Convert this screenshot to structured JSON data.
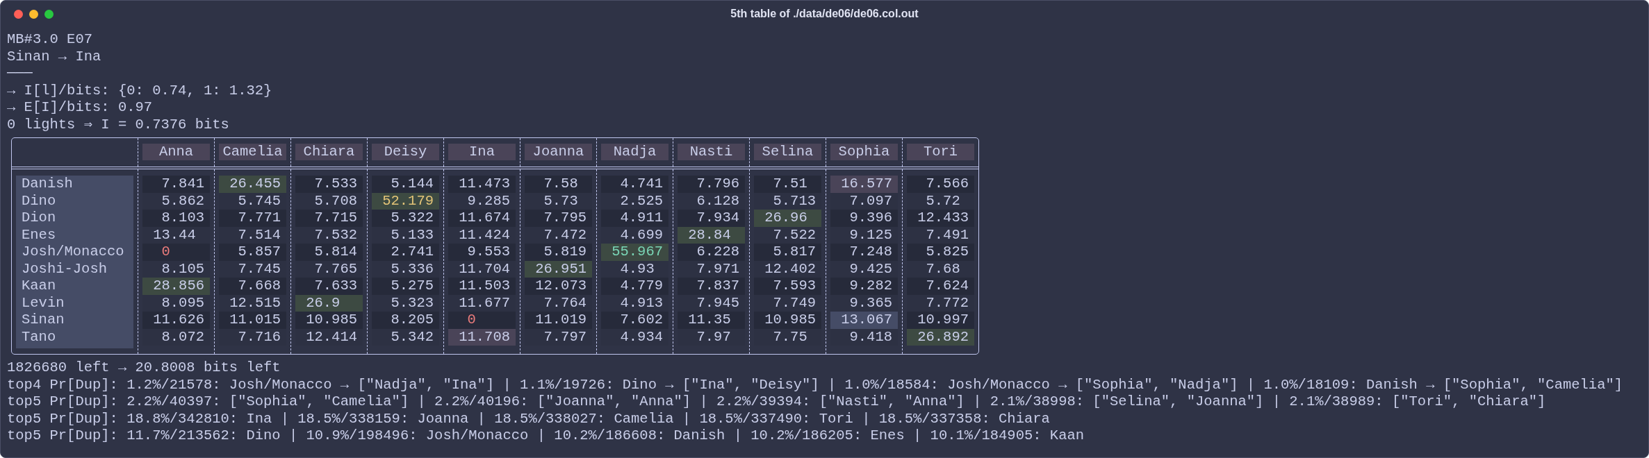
{
  "window": {
    "title": "5th table of ./data/de06/de06.col.out"
  },
  "header_lines": [
    "MB#3.0 E07",
    "Sinan → Ina",
    "───",
    "→ I[l]/bits: {0: 0.74, 1: 1.32}",
    "→ E[I]/bits: 0.97",
    "0 lights ⇒ I = 0.7376 bits"
  ],
  "table": {
    "columns": [
      "Anna",
      "Camelia",
      "Chiara",
      "Deisy",
      "Ina",
      "Joanna",
      "Nadja",
      "Nasti",
      "Selina",
      "Sophia",
      "Tori"
    ],
    "rows": [
      {
        "label": "Danish",
        "cells": [
          {
            "text": "7.841",
            "kind": "plain"
          },
          {
            "text": "26.455",
            "kind": "green"
          },
          {
            "text": "7.533",
            "kind": "plain"
          },
          {
            "text": "5.144",
            "kind": "plain"
          },
          {
            "text": "11.473",
            "kind": "plain"
          },
          {
            "text": "7.58",
            "kind": "plain"
          },
          {
            "text": "4.741",
            "kind": "plain"
          },
          {
            "text": "7.796",
            "kind": "plain"
          },
          {
            "text": "7.51",
            "kind": "plain"
          },
          {
            "text": "16.577",
            "kind": "mauve"
          },
          {
            "text": "7.566",
            "kind": "plain"
          }
        ]
      },
      {
        "label": "Dino",
        "cells": [
          {
            "text": "5.862",
            "kind": "plain"
          },
          {
            "text": "5.745",
            "kind": "plain"
          },
          {
            "text": "5.708",
            "kind": "plain"
          },
          {
            "text": "52.179",
            "kind": "gold"
          },
          {
            "text": "9.285",
            "kind": "plain"
          },
          {
            "text": "5.73",
            "kind": "plain"
          },
          {
            "text": "2.525",
            "kind": "plain"
          },
          {
            "text": "6.128",
            "kind": "plain"
          },
          {
            "text": "5.713",
            "kind": "plain"
          },
          {
            "text": "7.097",
            "kind": "plain"
          },
          {
            "text": "5.72",
            "kind": "plain"
          }
        ]
      },
      {
        "label": "Dion",
        "cells": [
          {
            "text": "8.103",
            "kind": "plain"
          },
          {
            "text": "7.771",
            "kind": "plain"
          },
          {
            "text": "7.715",
            "kind": "plain"
          },
          {
            "text": "5.322",
            "kind": "plain"
          },
          {
            "text": "11.674",
            "kind": "plain"
          },
          {
            "text": "7.795",
            "kind": "plain"
          },
          {
            "text": "4.911",
            "kind": "plain"
          },
          {
            "text": "7.934",
            "kind": "plain"
          },
          {
            "text": "26.96",
            "kind": "green"
          },
          {
            "text": "9.396",
            "kind": "plain"
          },
          {
            "text": "12.433",
            "kind": "plain"
          }
        ]
      },
      {
        "label": "Enes",
        "cells": [
          {
            "text": "13.44",
            "kind": "plain"
          },
          {
            "text": "7.514",
            "kind": "plain"
          },
          {
            "text": "7.532",
            "kind": "plain"
          },
          {
            "text": "5.133",
            "kind": "plain"
          },
          {
            "text": "11.424",
            "kind": "plain"
          },
          {
            "text": "7.472",
            "kind": "plain"
          },
          {
            "text": "4.699",
            "kind": "plain"
          },
          {
            "text": "28.84",
            "kind": "green"
          },
          {
            "text": "7.522",
            "kind": "plain"
          },
          {
            "text": "9.125",
            "kind": "plain"
          },
          {
            "text": "7.491",
            "kind": "plain"
          }
        ]
      },
      {
        "label": "Josh/Monacco",
        "cells": [
          {
            "text": "0",
            "kind": "zero"
          },
          {
            "text": "5.857",
            "kind": "plain"
          },
          {
            "text": "5.814",
            "kind": "plain"
          },
          {
            "text": "2.741",
            "kind": "plain"
          },
          {
            "text": "9.553",
            "kind": "plain"
          },
          {
            "text": "5.819",
            "kind": "plain"
          },
          {
            "text": "55.967",
            "kind": "teal"
          },
          {
            "text": "6.228",
            "kind": "plain"
          },
          {
            "text": "5.817",
            "kind": "plain"
          },
          {
            "text": "7.248",
            "kind": "plain"
          },
          {
            "text": "5.825",
            "kind": "plain"
          }
        ]
      },
      {
        "label": "Joshi-Josh",
        "cells": [
          {
            "text": "8.105",
            "kind": "plain"
          },
          {
            "text": "7.745",
            "kind": "plain"
          },
          {
            "text": "7.765",
            "kind": "plain"
          },
          {
            "text": "5.336",
            "kind": "plain"
          },
          {
            "text": "11.704",
            "kind": "plain"
          },
          {
            "text": "26.951",
            "kind": "green"
          },
          {
            "text": "4.93",
            "kind": "plain"
          },
          {
            "text": "7.971",
            "kind": "plain"
          },
          {
            "text": "12.402",
            "kind": "plain"
          },
          {
            "text": "9.425",
            "kind": "plain"
          },
          {
            "text": "7.68",
            "kind": "plain"
          }
        ]
      },
      {
        "label": "Kaan",
        "cells": [
          {
            "text": "28.856",
            "kind": "green"
          },
          {
            "text": "7.668",
            "kind": "plain"
          },
          {
            "text": "7.633",
            "kind": "plain"
          },
          {
            "text": "5.275",
            "kind": "plain"
          },
          {
            "text": "11.503",
            "kind": "plain"
          },
          {
            "text": "12.073",
            "kind": "plain"
          },
          {
            "text": "4.779",
            "kind": "plain"
          },
          {
            "text": "7.837",
            "kind": "plain"
          },
          {
            "text": "7.593",
            "kind": "plain"
          },
          {
            "text": "9.282",
            "kind": "plain"
          },
          {
            "text": "7.624",
            "kind": "plain"
          }
        ]
      },
      {
        "label": "Levin",
        "cells": [
          {
            "text": "8.095",
            "kind": "plain"
          },
          {
            "text": "12.515",
            "kind": "plain"
          },
          {
            "text": "26.9",
            "kind": "green"
          },
          {
            "text": "5.323",
            "kind": "plain"
          },
          {
            "text": "11.677",
            "kind": "plain"
          },
          {
            "text": "7.764",
            "kind": "plain"
          },
          {
            "text": "4.913",
            "kind": "plain"
          },
          {
            "text": "7.945",
            "kind": "plain"
          },
          {
            "text": "7.749",
            "kind": "plain"
          },
          {
            "text": "9.365",
            "kind": "plain"
          },
          {
            "text": "7.772",
            "kind": "plain"
          }
        ]
      },
      {
        "label": "Sinan",
        "cells": [
          {
            "text": "11.626",
            "kind": "plain"
          },
          {
            "text": "11.015",
            "kind": "plain"
          },
          {
            "text": "10.985",
            "kind": "plain"
          },
          {
            "text": "8.205",
            "kind": "plain"
          },
          {
            "text": "0",
            "kind": "zero"
          },
          {
            "text": "11.019",
            "kind": "plain"
          },
          {
            "text": "7.602",
            "kind": "plain"
          },
          {
            "text": "11.35",
            "kind": "plain"
          },
          {
            "text": "10.985",
            "kind": "plain"
          },
          {
            "text": "13.067",
            "kind": "slate"
          },
          {
            "text": "10.997",
            "kind": "plain"
          }
        ]
      },
      {
        "label": "Tano",
        "cells": [
          {
            "text": "8.072",
            "kind": "plain"
          },
          {
            "text": "7.716",
            "kind": "plain"
          },
          {
            "text": "12.414",
            "kind": "plain"
          },
          {
            "text": "5.342",
            "kind": "plain"
          },
          {
            "text": "11.708",
            "kind": "mauve"
          },
          {
            "text": "7.797",
            "kind": "plain"
          },
          {
            "text": "4.934",
            "kind": "plain"
          },
          {
            "text": "7.97",
            "kind": "plain"
          },
          {
            "text": "7.75",
            "kind": "plain"
          },
          {
            "text": "9.418",
            "kind": "plain"
          },
          {
            "text": "26.892",
            "kind": "green"
          }
        ]
      }
    ]
  },
  "footer_lines": [
    "1826680 left → 20.8008 bits left",
    "top4 Pr[Dup]: 1.2%/21578: Josh/Monacco → [\"Nadja\", \"Ina\"] | 1.1%/19726: Dino → [\"Ina\", \"Deisy\"] | 1.0%/18584: Josh/Monacco → [\"Sophia\", \"Nadja\"] | 1.0%/18109: Danish → [\"Sophia\", \"Camelia\"]",
    "top5 Pr[Dup]: 2.2%/40397: [\"Sophia\", \"Camelia\"] | 2.2%/40196: [\"Joanna\", \"Anna\"] | 2.2%/39394: [\"Nasti\", \"Anna\"] | 2.1%/38998: [\"Selina\", \"Joanna\"] | 2.1%/38989: [\"Tori\", \"Chiara\"]",
    "top5 Pr[Dup]: 18.8%/342810: Ina | 18.5%/338159: Joanna | 18.5%/338027: Camelia | 18.5%/337490: Tori | 18.5%/337358: Chiara",
    "top5 Pr[Dup]: 11.7%/213562: Dino | 10.9%/198496: Josh/Monacco | 10.2%/186608: Danish | 10.2%/186205: Enes | 10.1%/184905: Kaan"
  ]
}
